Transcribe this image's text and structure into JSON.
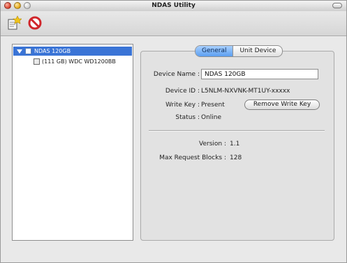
{
  "window": {
    "title": "NDAS Utility"
  },
  "toolbar": {
    "register_icon": "register-device-icon",
    "unregister_icon": "unregister-device-icon"
  },
  "tree": {
    "root": {
      "label": "NDAS 120GB"
    },
    "child": {
      "label": "(111 GB) WDC WD1200BB"
    }
  },
  "tabs": [
    {
      "label": "General",
      "active": true
    },
    {
      "label": "Unit Device",
      "active": false
    }
  ],
  "general": {
    "device_name_label": "Device Name :",
    "device_name_value": "NDAS 120GB",
    "device_id_label": "Device ID :",
    "device_id_value": "L5NLM-NXVNK-MT1UY-xxxxx",
    "write_key_label": "Write Key :",
    "write_key_value": "Present",
    "remove_write_key_button": "Remove Write Key",
    "status_label": "Status :",
    "status_value": "Online",
    "version_label": "Version :",
    "version_value": "1.1",
    "max_request_blocks_label": "Max Request Blocks :",
    "max_request_blocks_value": "128"
  },
  "colors": {
    "selection": "#3a74d6",
    "tab_active": "#5c9ff1"
  }
}
